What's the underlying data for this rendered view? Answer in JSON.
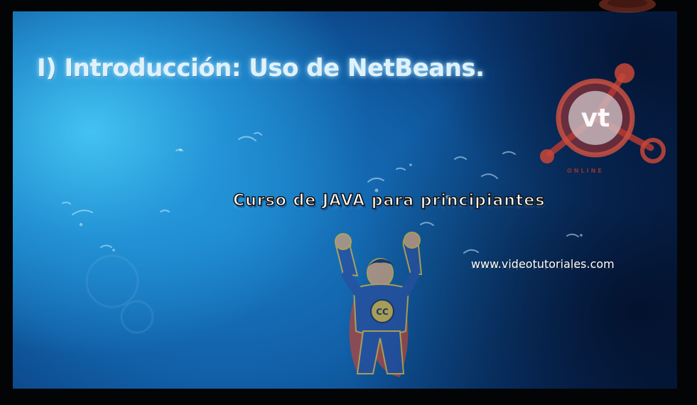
{
  "slide": {
    "title": "I) Introducción: Uso de NetBeans.",
    "subtitle": "Curso de JAVA para principiantes",
    "url": "www.videotutoriales.com"
  },
  "logo": {
    "initials": "vt",
    "tagline": "ONLINE",
    "icon": "molecule-logo-icon"
  },
  "mascot": {
    "badge": "CC",
    "icon": "superhero-mascot-icon"
  },
  "colors": {
    "background_light": "#3fc0f0",
    "background_mid": "#1166b0",
    "background_dark": "#06214a",
    "logo_red": "#b8352c",
    "title_glow": "#dff2fb"
  }
}
